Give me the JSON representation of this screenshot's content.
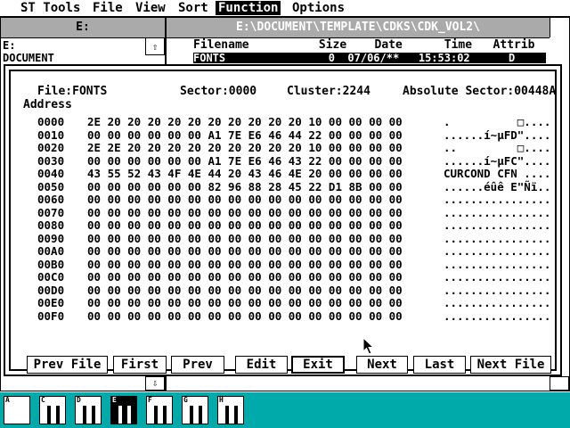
{
  "menubar": {
    "items": [
      {
        "label": "ST Tools",
        "active": false
      },
      {
        "label": "File",
        "active": false
      },
      {
        "label": "View",
        "active": false
      },
      {
        "label": "Sort",
        "active": false
      },
      {
        "label": "Function",
        "active": true
      },
      {
        "label": "Options",
        "active": false
      }
    ]
  },
  "left_window": {
    "title": "E:",
    "path": "E:",
    "item": "DOCUMENT",
    "scroll_up": "⇧",
    "scroll_down": "⇩"
  },
  "right_window": {
    "title": "E:\\DOCUMENT\\TEMPLATE\\CDKS\\CDK_VOL2\\",
    "header": "Filename          Size    Date      Time   Attrib",
    "row": "FONTS                0  07/06/**   15:53:02      D"
  },
  "dialog": {
    "file_label": "File:FONTS",
    "sector_label": "Sector:0000",
    "cluster_label": "Cluster:2244",
    "abs_label": "Absolute Sector:00448A",
    "address_label": "Address",
    "rows": [
      {
        "addr": "0000",
        "hex": "2E 20 20 20 20 20 20 20 20 20 20 10 00 00 00 00",
        "ascii": ".          □...."
      },
      {
        "addr": "0010",
        "hex": "00 00 00 00 00 00 A1 7E E6 46 44 22 00 00 00 00",
        "ascii": "......í~µFD\"...."
      },
      {
        "addr": "0020",
        "hex": "2E 2E 20 20 20 20 20 20 20 20 20 10 00 00 00 00",
        "ascii": "..         □...."
      },
      {
        "addr": "0030",
        "hex": "00 00 00 00 00 00 A1 7E E6 46 43 22 00 00 00 00",
        "ascii": "......í~µFC\"...."
      },
      {
        "addr": "0040",
        "hex": "43 55 52 43 4F 4E 44 20 43 46 4E 20 00 00 00 00",
        "ascii": "CURCOND CFN ...."
      },
      {
        "addr": "0050",
        "hex": "00 00 00 00 00 00 82 96 88 28 45 22 D1 8B 00 00",
        "ascii": "......éûê E\"Ñï.."
      },
      {
        "addr": "0060",
        "hex": "00 00 00 00 00 00 00 00 00 00 00 00 00 00 00 00",
        "ascii": "................"
      },
      {
        "addr": "0070",
        "hex": "00 00 00 00 00 00 00 00 00 00 00 00 00 00 00 00",
        "ascii": "................"
      },
      {
        "addr": "0080",
        "hex": "00 00 00 00 00 00 00 00 00 00 00 00 00 00 00 00",
        "ascii": "................"
      },
      {
        "addr": "0090",
        "hex": "00 00 00 00 00 00 00 00 00 00 00 00 00 00 00 00",
        "ascii": "................"
      },
      {
        "addr": "00A0",
        "hex": "00 00 00 00 00 00 00 00 00 00 00 00 00 00 00 00",
        "ascii": "................"
      },
      {
        "addr": "00B0",
        "hex": "00 00 00 00 00 00 00 00 00 00 00 00 00 00 00 00",
        "ascii": "................"
      },
      {
        "addr": "00C0",
        "hex": "00 00 00 00 00 00 00 00 00 00 00 00 00 00 00 00",
        "ascii": "................"
      },
      {
        "addr": "00D0",
        "hex": "00 00 00 00 00 00 00 00 00 00 00 00 00 00 00 00",
        "ascii": "................"
      },
      {
        "addr": "00E0",
        "hex": "00 00 00 00 00 00 00 00 00 00 00 00 00 00 00 00",
        "ascii": "................"
      },
      {
        "addr": "00F0",
        "hex": "00 00 00 00 00 00 00 00 00 00 00 00 00 00 00 00",
        "ascii": "................"
      }
    ],
    "buttons": {
      "prev_file": "Prev File",
      "first": "First",
      "prev": "Prev",
      "edit": "Edit",
      "exit": "Exit",
      "next": "Next",
      "last": "Last",
      "next_file": "Next File"
    }
  },
  "drives": [
    {
      "letter": "A"
    },
    {
      "letter": "C"
    },
    {
      "letter": "D"
    },
    {
      "letter": "E"
    },
    {
      "letter": "F"
    },
    {
      "letter": "G"
    },
    {
      "letter": "H"
    }
  ]
}
